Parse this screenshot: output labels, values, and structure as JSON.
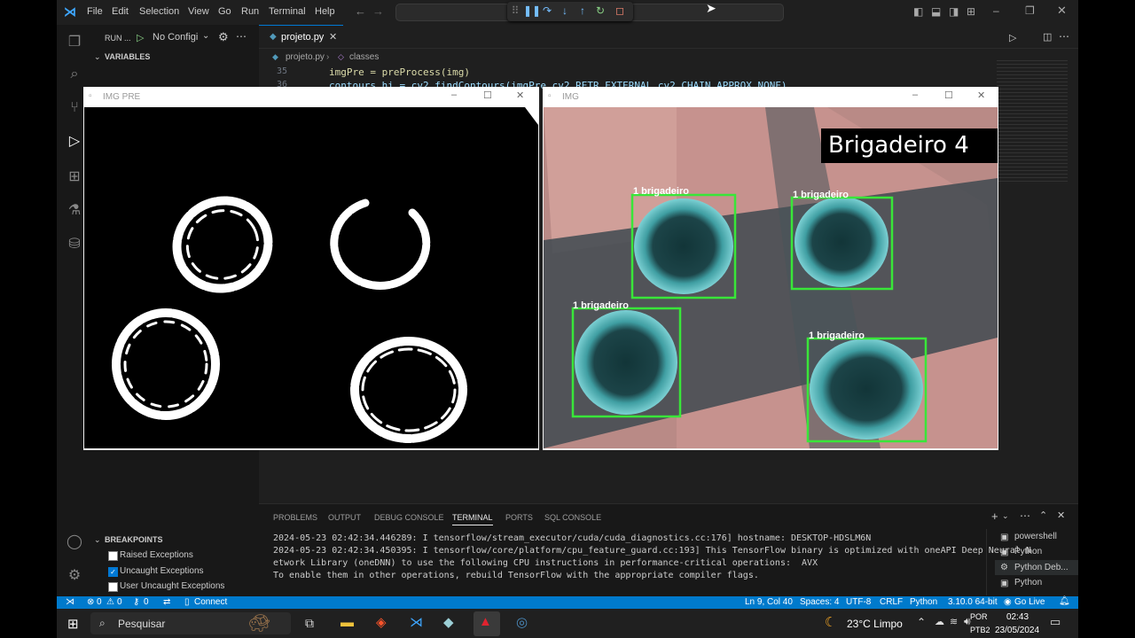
{
  "menu": [
    "File",
    "Edit",
    "Selection",
    "View",
    "Go",
    "Run",
    "Terminal",
    "Help"
  ],
  "run": {
    "label": "RUN ...",
    "config": "No Configi"
  },
  "sidebar": {
    "variables": "VARIABLES",
    "breakpoints": "BREAKPOINTS",
    "bp_items": [
      "Raised Exceptions",
      "Uncaught Exceptions",
      "User Uncaught Exceptions"
    ],
    "bp_checked": [
      false,
      true,
      false
    ]
  },
  "editor": {
    "tab": "projeto.py",
    "breadcrumb_file": "projeto.py",
    "breadcrumb_sym": "classes",
    "line_no_35": "35",
    "line_no_36": "36",
    "code_35": "imgPre = preProcess(img)",
    "code_36": "contours,hi = cv2.findContours(imgPre,cv2.RETR_EXTERNAL,cv2.CHAIN_APPROX_NONE)"
  },
  "win_pre": {
    "title": "IMG PRE"
  },
  "win_img": {
    "title": "IMG",
    "overlay": "Brigadeiro 4",
    "labels": [
      "1 brigadeiro",
      "1 brigadeiro",
      "1 brigadeiro",
      "1 brigadeiro"
    ]
  },
  "panel": {
    "tabs": [
      "PROBLEMS",
      "OUTPUT",
      "DEBUG CONSOLE",
      "TERMINAL",
      "PORTS",
      "SQL CONSOLE"
    ],
    "lines": [
      "2024-05-23 02:42:34.446289: I tensorflow/stream_executor/cuda/cuda_diagnostics.cc:176] hostname: DESKTOP-HDSLM6N",
      "2024-05-23 02:42:34.450395: I tensorflow/core/platform/cpu_feature_guard.cc:193] This TensorFlow binary is optimized with oneAPI Deep Neural N",
      "etwork Library (oneDNN) to use the following CPU instructions in performance-critical operations:  AVX",
      "To enable them in other operations, rebuild TensorFlow with the appropriate compiler flags."
    ],
    "terminals": [
      "powershell",
      "Python",
      "Python Deb...",
      "Python"
    ]
  },
  "status": {
    "errors": "0",
    "warnings": "0",
    "ports": "0",
    "connect": "Connect",
    "position": "Ln 9, Col 40",
    "spaces": "Spaces: 4",
    "encoding": "UTF-8",
    "eol": "CRLF",
    "language": "Python",
    "interpreter": "3.10.0 64-bit",
    "golive": "Go Live"
  },
  "taskbar": {
    "search": "Pesquisar",
    "weather": "23°C  Limpo",
    "lang1": "POR",
    "lang2": "PTB2",
    "time": "02:43",
    "date": "23/05/2024"
  },
  "colors": {
    "accent": "#007acc",
    "box": "#39e639",
    "bg": "#1f1f1f"
  }
}
